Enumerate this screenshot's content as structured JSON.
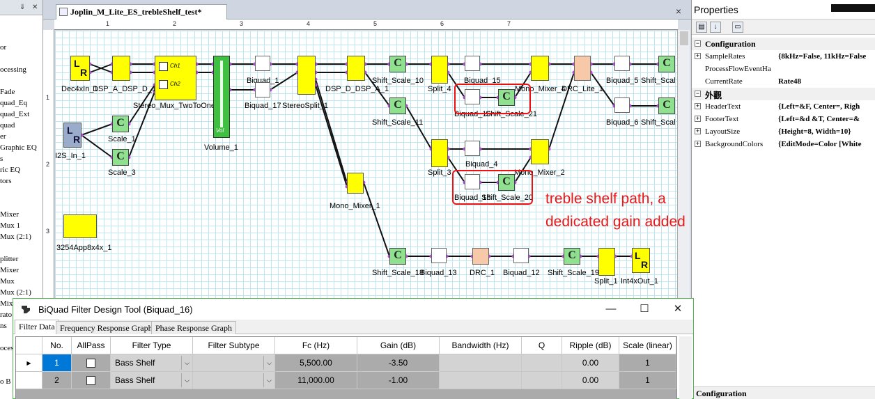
{
  "toolbox": {
    "items": [
      "or",
      "ocessing",
      "Fade",
      "quad_Eq",
      "quad_Ext",
      "quad",
      "er",
      "Graphic EQ",
      "s",
      "ric EQ",
      "tors",
      "Mixer",
      "Mux 1",
      "Mux (2:1)",
      "plitter",
      "Mixer",
      "Mux",
      "Mux (2:1)",
      "Mixe",
      "rato",
      "ns",
      "oces",
      "o B"
    ]
  },
  "document": {
    "tab_title": "Joplin_M_Lite_ES_trebleShelf_test*",
    "close": "×"
  },
  "ruler": {
    "h_marks": [
      "1",
      "2",
      "3",
      "4",
      "5",
      "6",
      "7"
    ],
    "v_marks": [
      "1",
      "2",
      "3"
    ]
  },
  "blocks": {
    "dec4xin": "Dec4xIn_1",
    "dsp_a": "DSP_A_DSP_D_1",
    "stereo_mux": "Stereo_Mux_TwoToOne_1",
    "ch1": "Ch1",
    "ch2": "Ch2",
    "volume": "Volume_1",
    "vol_text": "Vol",
    "biquad_1": "Biquad_1",
    "biquad_17": "Biquad_17",
    "stereosplit": "StereoSplit_1",
    "dsp_d": "DSP_D_DSP_A_1",
    "shift_scale_10": "Shift_Scale_10",
    "shift_scale_11": "Shift_Scale_11",
    "split_4": "Split_4",
    "biquad_15": "Biquad_15",
    "biquad_16": "Biquad_16",
    "shift_scale_21": "Shift_Scale_21",
    "mono_mixer_4": "Mono_Mixer_4",
    "drc_lite": "DRC_Lite_1",
    "biquad_5": "Biquad_5",
    "shift_scale_a": "Shift_Scal",
    "biquad_6": "Biquad_6",
    "shift_scale_b": "Shift_Scal",
    "i2s_in": "I2S_In_1",
    "scale_1": "Scale_1",
    "scale_3": "Scale_3",
    "split_3": "Split_3",
    "biquad_4": "Biquad_4",
    "biquad_18": "Biquad_18",
    "shift_scale_20": "Shift_Scale_20",
    "mono_mixer_2": "Mono_Mixer_2",
    "mono_mixer_1": "Mono_Mixer_1",
    "app": "3254App8x4x_1",
    "shift_scale_18": "Shift_Scale_18",
    "biquad_13": "Biquad_13",
    "drc_1": "DRC_1",
    "biquad_12": "Biquad_12",
    "shift_scale_19": "Shift_Scale_19",
    "split_1": "Split_1",
    "int4xout": "Int4xOut_1",
    "c": "C"
  },
  "annotation": {
    "line1": "treble shelf path, a",
    "line2": "dedicated gain added"
  },
  "properties": {
    "title": "Properties",
    "cat_config": "Configuration",
    "rows1": [
      {
        "name": "SampleRates",
        "value": "{8kHz=False, 11kHz=False"
      },
      {
        "name": "ProcessFlowEventHa",
        "value": ""
      },
      {
        "name": "CurrentRate",
        "value": "Rate48"
      }
    ],
    "cat_appearance": "外觀",
    "rows2": [
      {
        "name": "HeaderText",
        "value": "{Left=&F, Center=, Righ"
      },
      {
        "name": "FooterText",
        "value": "{Left=&d    &T, Center=&"
      },
      {
        "name": "LayoutSize",
        "value": "{Height=8, Width=10}"
      },
      {
        "name": "BackgroundColors",
        "value": "{EditMode=Color [White"
      }
    ],
    "footer": "Configuration"
  },
  "dialog": {
    "title": "BiQuad Filter Design Tool (Biquad_16)",
    "minimize": "—",
    "maximize": "☐",
    "close": "✕",
    "tabs": [
      "Filter Data",
      "Frequency Response Graph",
      "Phase Response Graph"
    ],
    "columns": [
      "No.",
      "AllPass",
      "Filter Type",
      "Filter Subtype",
      "Fc (Hz)",
      "Gain (dB)",
      "Bandwidth (Hz)",
      "Q",
      "Ripple (dB)",
      "Scale (linear)"
    ],
    "rows": [
      {
        "no": "1",
        "filter_type": "Bass Shelf",
        "filter_subtype": "",
        "fc": "5,500.00",
        "gain": "-3.50",
        "bandwidth": "",
        "q": "",
        "ripple": "0.00",
        "scale": "1"
      },
      {
        "no": "2",
        "filter_type": "Bass Shelf",
        "filter_subtype": "",
        "fc": "11,000.00",
        "gain": "-1.00",
        "bandwidth": "",
        "q": "",
        "ripple": "0.00",
        "scale": "1"
      }
    ]
  },
  "colors": {
    "accent": "#0078d7",
    "annotation": "#e81818",
    "block_yellow": "#ffff00",
    "block_green": "#8fe08f"
  }
}
